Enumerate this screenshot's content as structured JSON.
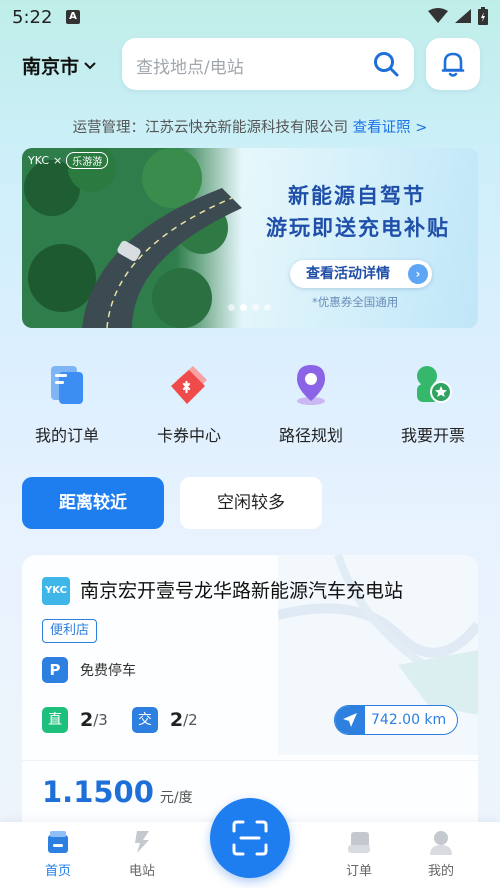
{
  "status_bar": {
    "time": "5:22",
    "notification_letter": "A"
  },
  "header": {
    "city": "南京市",
    "search_placeholder": "查找地点/电站"
  },
  "operator": {
    "text": "运营管理：江苏云快充新能源科技有限公司",
    "link": "查看证照 >"
  },
  "banner": {
    "logo": "YKC",
    "partner": "乐游游",
    "title_line1": "新能源自驾节",
    "title_line2": "游玩即送充电补贴",
    "button": "查看活动详情",
    "note": "*优惠券全国通用",
    "slide_count": 4,
    "active_slide": 2
  },
  "shortcuts": [
    {
      "label": "我的订单",
      "icon": "orders-icon"
    },
    {
      "label": "卡券中心",
      "icon": "coupon-icon"
    },
    {
      "label": "路径规划",
      "icon": "route-pin-icon"
    },
    {
      "label": "我要开票",
      "icon": "invoice-icon"
    }
  ],
  "filters": {
    "nearest": "距离较近",
    "idle": "空闲较多",
    "selected": "nearest"
  },
  "station": {
    "logo": "YKC",
    "name": "南京宏开壹号龙华路新能源汽车充电站",
    "tag": "便利店",
    "parking_badge": "P",
    "parking": "免费停车",
    "dc_label": "直",
    "dc_available": "2",
    "dc_total": "/3",
    "ac_label": "交",
    "ac_available": "2",
    "ac_total": "/2",
    "distance": "742.00 km",
    "price": "1.1500",
    "price_unit": "元/度"
  },
  "bottom_nav": [
    {
      "label": "首页",
      "active": true
    },
    {
      "label": "电站",
      "active": false
    },
    {
      "label": "订单",
      "active": false
    },
    {
      "label": "我的",
      "active": false
    }
  ],
  "colors": {
    "primary": "#1e7ef0",
    "dc_green": "#1dbf7c",
    "banner_text": "#1f4fa8"
  }
}
